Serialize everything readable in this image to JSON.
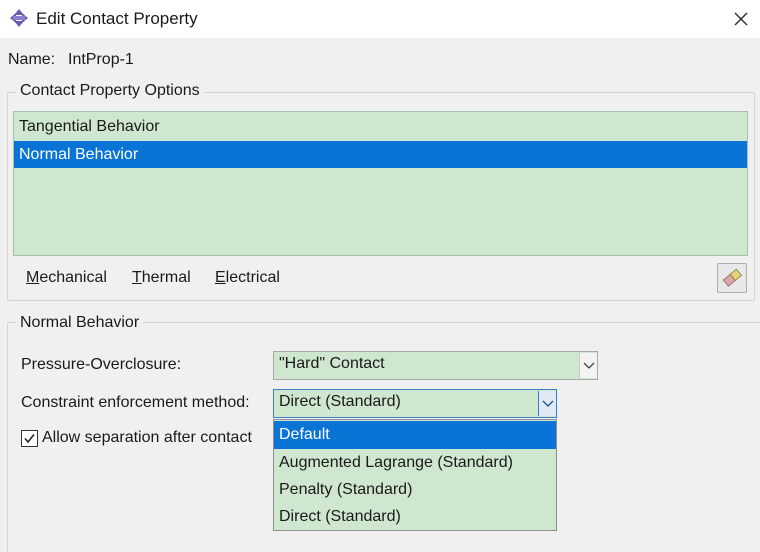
{
  "window": {
    "title": "Edit Contact Property",
    "icon": "app-arrows-icon",
    "close_icon": "close-icon"
  },
  "name": {
    "label": "Name:",
    "value": "IntProp-1"
  },
  "options_group": {
    "title": "Contact Property Options",
    "items": [
      "Tangential Behavior",
      "Normal Behavior"
    ],
    "selected_index": 1
  },
  "menu": {
    "mechanical": {
      "first": "M",
      "rest": "echanical"
    },
    "thermal": {
      "first": "T",
      "rest": "hermal"
    },
    "electrical": {
      "first": "E",
      "rest": "lectrical"
    },
    "eraser_icon": "eraser-icon"
  },
  "normal_group": {
    "title": "Normal Behavior",
    "pressure_label": "Pressure-Overclosure:",
    "pressure_value": "\"Hard\" Contact",
    "constraint_label": "Constraint enforcement method:",
    "constraint_value": "Direct (Standard)",
    "allow_separation_label": "Allow separation after contact",
    "allow_separation_checked": true
  },
  "dropdown": {
    "options": [
      "Default",
      "Augmented Lagrange (Standard)",
      "Penalty (Standard)",
      "Direct (Standard)"
    ],
    "highlighted_index": 0
  },
  "colors": {
    "selection": "#0a74d6",
    "list_background": "#cfe6cf",
    "dialog_background": "#f0f0f0"
  }
}
